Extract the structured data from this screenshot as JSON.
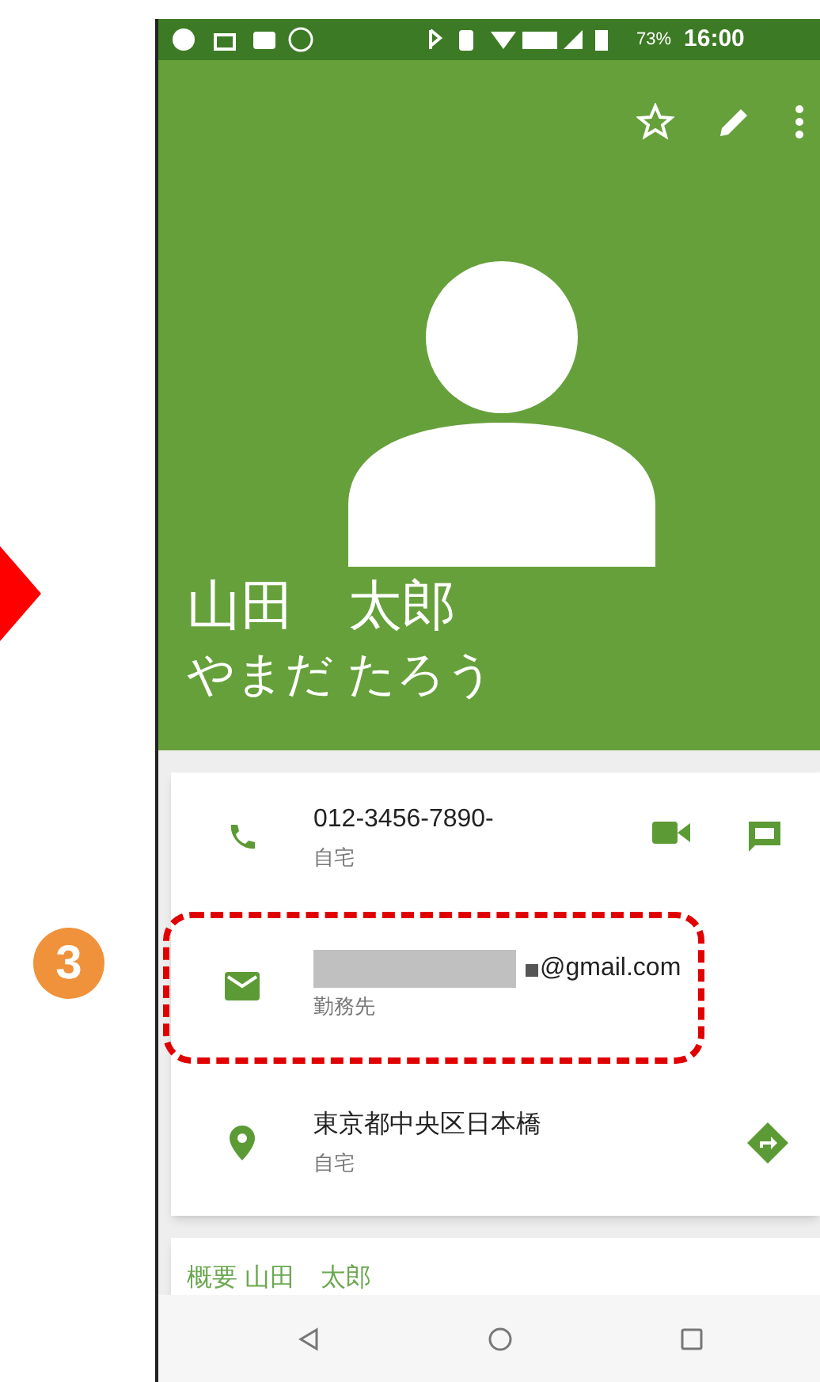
{
  "annotation": {
    "step": "3"
  },
  "status_bar": {
    "battery": "73%",
    "time": "16:00"
  },
  "contact": {
    "name": "山田　太郎",
    "reading": "やまだ たろう"
  },
  "details": [
    {
      "kind": "phone",
      "value": "012-3456-7890-",
      "label": "自宅",
      "highlighted": false
    },
    {
      "kind": "email",
      "value": "@gmail.com",
      "redacted": true,
      "label": "勤務先",
      "highlighted": true
    },
    {
      "kind": "address",
      "value": "東京都中央区日本橋",
      "label": "自宅",
      "highlighted": false
    }
  ],
  "about": {
    "title": "概要 山田　太郎"
  }
}
